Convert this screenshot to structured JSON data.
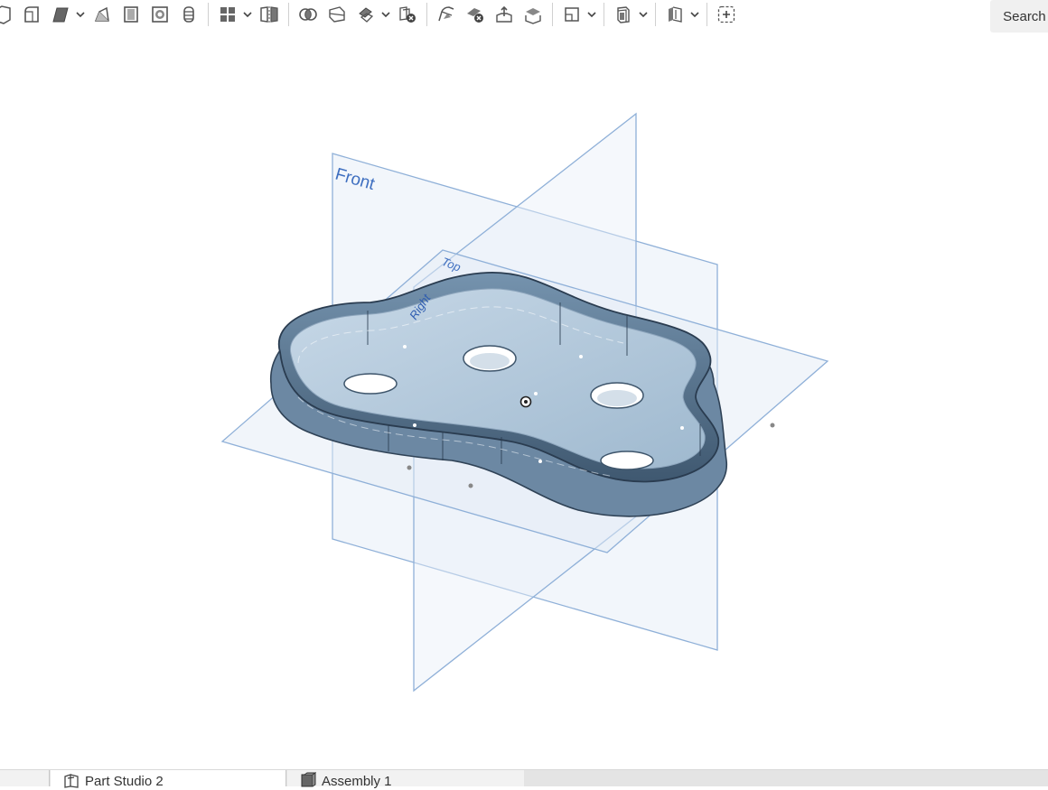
{
  "toolbar": {
    "search_label": "Search t",
    "tools": [
      {
        "name": "fillet-icon"
      },
      {
        "name": "chamfer-icon",
        "caret": true
      },
      {
        "name": "draft-icon"
      },
      {
        "name": "shell-icon"
      },
      {
        "name": "hole-icon"
      },
      {
        "name": "thread-icon"
      },
      {
        "name": "pattern-icon",
        "caret": true
      },
      {
        "name": "mirror-icon"
      },
      {
        "name": "boolean-icon"
      },
      {
        "name": "split-icon"
      },
      {
        "name": "transform-icon",
        "caret": true
      },
      {
        "name": "delete-part-icon"
      },
      {
        "name": "modify-fillet-icon"
      },
      {
        "name": "delete-face-icon"
      },
      {
        "name": "move-face-icon"
      },
      {
        "name": "replace-face-icon"
      },
      {
        "name": "plane-icon",
        "caret": true
      },
      {
        "name": "sheet-metal-icon",
        "caret": true
      },
      {
        "name": "surface-icon",
        "caret": true
      },
      {
        "name": "add-custom-feature-icon"
      }
    ]
  },
  "viewport": {
    "planes": {
      "front_label": "Front",
      "top_label": "Top",
      "right_label": "Right"
    },
    "colors": {
      "plane_stroke": "#8fb0d8",
      "plane_fill": "#e8eff8",
      "plane_label": "#3f6fc0",
      "part_body": "#8da9c2",
      "part_dark": "#4a6580",
      "part_light": "#b8ccdd"
    }
  },
  "tabs": [
    {
      "label": "",
      "icon": ""
    },
    {
      "label": "Part Studio 2",
      "icon": "part-studio-icon"
    },
    {
      "label": "Assembly 1",
      "icon": "assembly-icon"
    }
  ]
}
